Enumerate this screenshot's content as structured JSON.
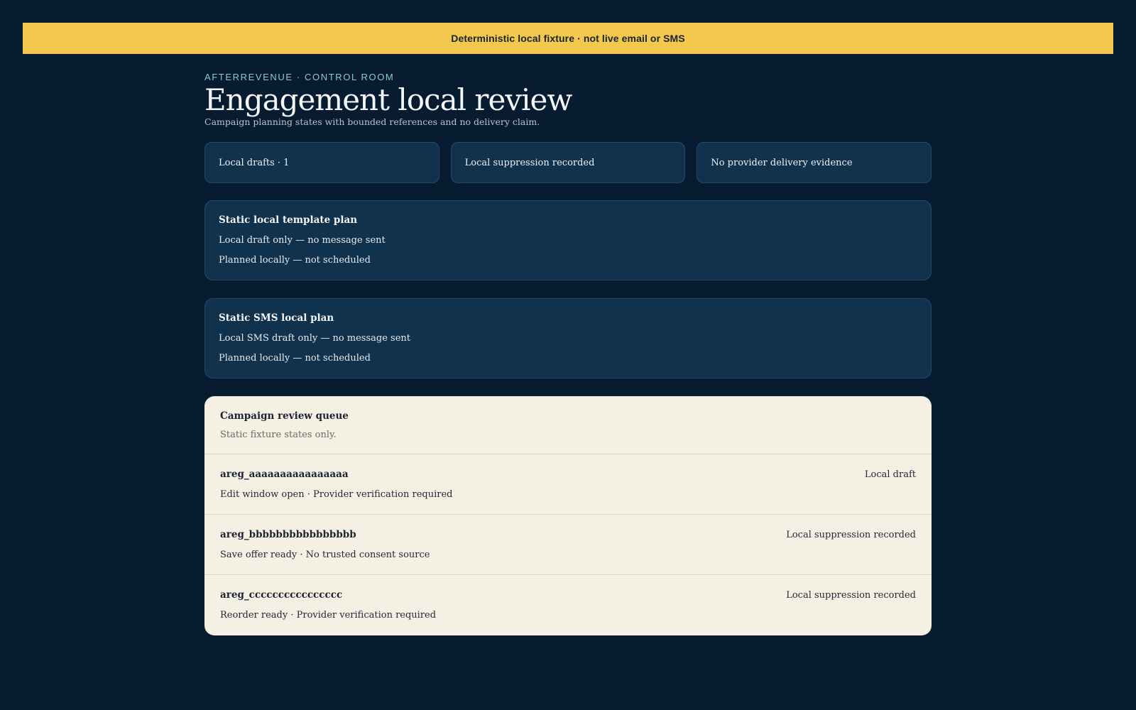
{
  "banner": {
    "text": "Deterministic local fixture · not live email or SMS"
  },
  "header": {
    "eyebrow": "AFTERREVENUE · CONTROL ROOM",
    "title": "Engagement local review",
    "subtitle": "Campaign planning states with bounded references and no delivery claim."
  },
  "metrics": [
    {
      "label": "Local drafts · 1"
    },
    {
      "label": "Local suppression recorded"
    },
    {
      "label": "No provider delivery evidence"
    }
  ],
  "plans": [
    {
      "title": "Static local template plan",
      "lines": [
        "Local draft only — no message sent",
        "Planned locally — not scheduled"
      ]
    },
    {
      "title": "Static SMS local plan",
      "lines": [
        "Local SMS draft only — no message sent",
        "Planned locally — not scheduled"
      ]
    }
  ],
  "queue": {
    "title": "Campaign review queue",
    "subtitle": "Static fixture states only.",
    "rows": [
      {
        "id": "areg_aaaaaaaaaaaaaaaa",
        "detail": "Edit window open · Provider verification required",
        "status": "Local draft"
      },
      {
        "id": "areg_bbbbbbbbbbbbbbbb",
        "detail": "Save offer ready · No trusted consent source",
        "status": "Local suppression recorded"
      },
      {
        "id": "areg_cccccccccccccccc",
        "detail": "Reorder ready · Provider verification required",
        "status": "Local suppression recorded"
      }
    ]
  }
}
